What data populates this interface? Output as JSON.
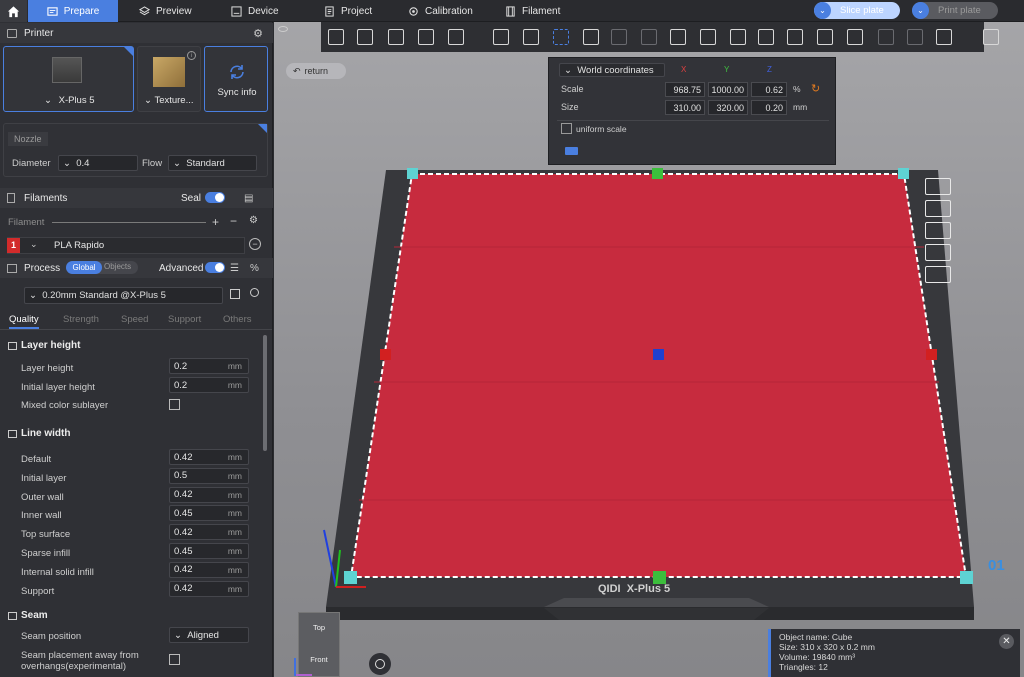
{
  "topbar": {
    "tabs": [
      {
        "label": "Prepare",
        "icon": "prepare-icon"
      },
      {
        "label": "Preview",
        "icon": "preview-icon"
      },
      {
        "label": "Device",
        "icon": "device-icon"
      },
      {
        "label": "Project",
        "icon": "project-icon"
      },
      {
        "label": "Calibration",
        "icon": "calibration-icon"
      },
      {
        "label": "Filament",
        "icon": "filament-icon"
      }
    ],
    "slice_label": "Slice plate",
    "print_label": "Print plate",
    "accent": "#4a7fe0"
  },
  "printer": {
    "title": "Printer",
    "printer_name": "X-Plus 5",
    "texture_label": "Texture...",
    "sync_label": "Sync info",
    "nozzle_label": "Nozzle",
    "diameter_label": "Diameter",
    "diameter_value": "0.4",
    "flow_label": "Flow",
    "flow_value": "Standard"
  },
  "filaments": {
    "title": "Filaments",
    "seal_label": "Seal",
    "filament_label": "Filament",
    "items": [
      {
        "index": "1",
        "name": "PLA Rapido",
        "color": "#d22b2b"
      }
    ]
  },
  "process": {
    "title": "Process",
    "global_label": "Global",
    "objects_label": "Objects",
    "advanced_label": "Advanced",
    "preset": "0.20mm Standard @X-Plus 5",
    "tabs": [
      "Quality",
      "Strength",
      "Speed",
      "Support",
      "Others"
    ],
    "groups": {
      "layer_height": {
        "title": "Layer height",
        "rows": [
          {
            "label": "Layer height",
            "value": "0.2",
            "unit": "mm"
          },
          {
            "label": "Initial layer height",
            "value": "0.2",
            "unit": "mm"
          }
        ],
        "mixed_label": "Mixed color sublayer"
      },
      "line_width": {
        "title": "Line width",
        "rows": [
          {
            "label": "Default",
            "value": "0.42",
            "unit": "mm"
          },
          {
            "label": "Initial layer",
            "value": "0.5",
            "unit": "mm"
          },
          {
            "label": "Outer wall",
            "value": "0.42",
            "unit": "mm"
          },
          {
            "label": "Inner wall",
            "value": "0.45",
            "unit": "mm"
          },
          {
            "label": "Top surface",
            "value": "0.42",
            "unit": "mm"
          },
          {
            "label": "Sparse infill",
            "value": "0.45",
            "unit": "mm"
          },
          {
            "label": "Internal solid infill",
            "value": "0.42",
            "unit": "mm"
          },
          {
            "label": "Support",
            "value": "0.42",
            "unit": "mm"
          }
        ]
      },
      "seam": {
        "title": "Seam",
        "position_label": "Seam position",
        "position_value": "Aligned",
        "away_label": "Seam placement away from",
        "away_label2": "overhangs(experimental)"
      }
    }
  },
  "viewport": {
    "return_label": "return",
    "scale_popup": {
      "coord_label": "World coordinates",
      "axes": [
        "X",
        "Y",
        "Z"
      ],
      "scale_label": "Scale",
      "scale_values": [
        "968.75",
        "1000.00",
        "0.62"
      ],
      "scale_unit": "%",
      "size_label": "Size",
      "size_values": [
        "310.00",
        "320.00",
        "0.20"
      ],
      "size_unit": "mm",
      "uniform_label": "uniform scale"
    },
    "bed_brand": "QIDI  X-Plus 5",
    "plate_number": "01",
    "view_top": "Top",
    "view_front": "Front",
    "object_color": "#c72b3e",
    "info": {
      "name": "Object name: Cube",
      "size": "Size: 310 x 320 x 0.2 mm",
      "volume": "Volume: 19840 mm³",
      "triangles": "Triangles: 12"
    }
  }
}
